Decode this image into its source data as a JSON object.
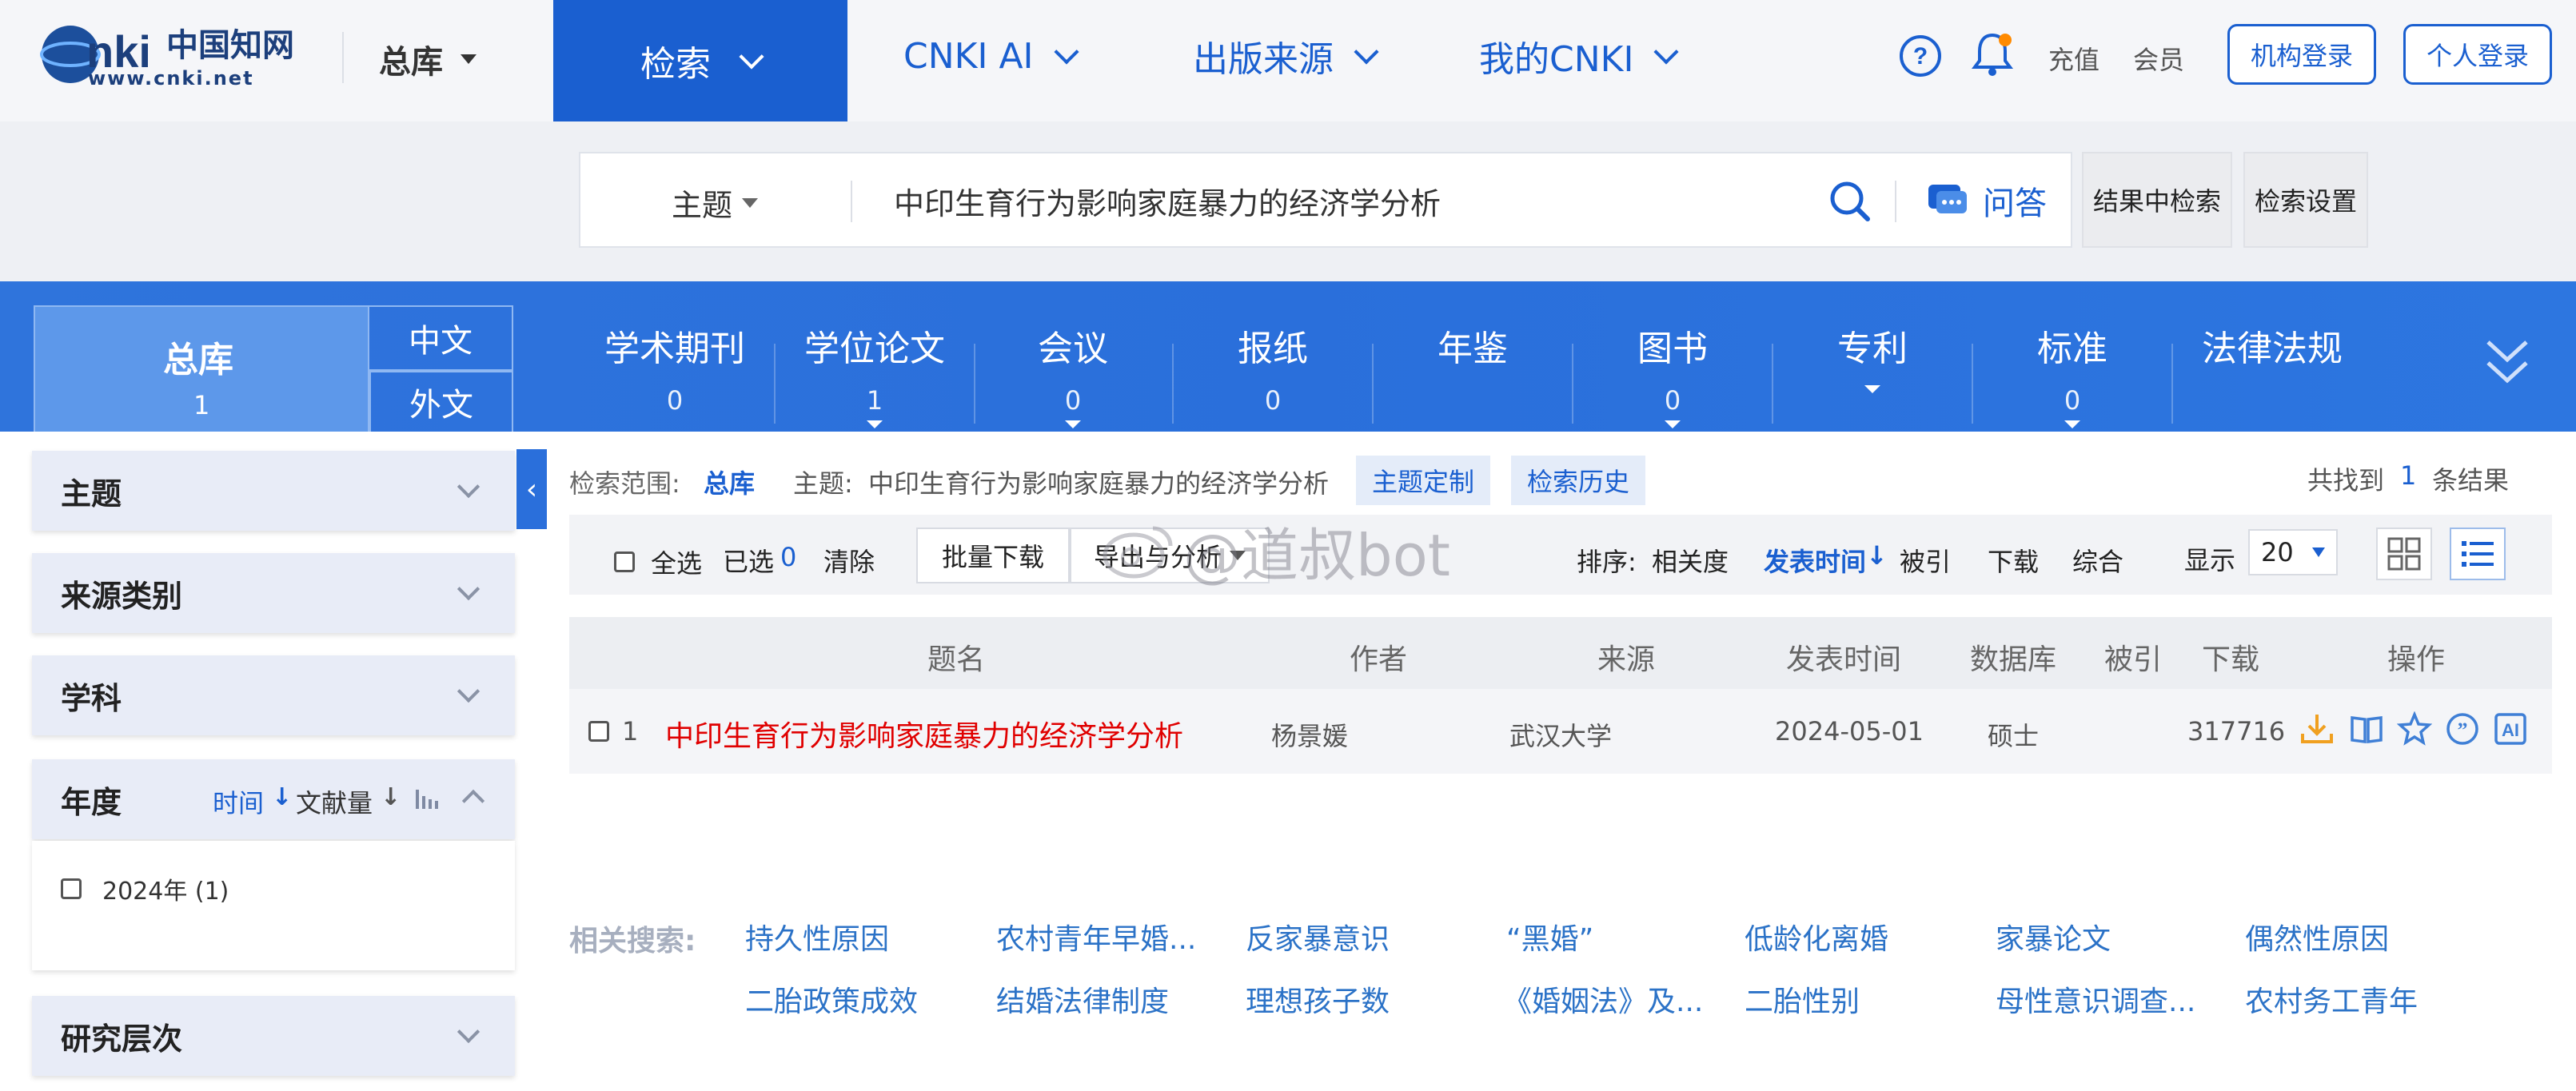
{
  "logo": {
    "text_cn": "中国知网",
    "text_url": "www.cnki.net"
  },
  "header": {
    "library_label": "总库",
    "nav": [
      {
        "label": "检索"
      },
      {
        "label": "CNKI AI"
      },
      {
        "label": "出版来源"
      },
      {
        "label": "我的CNKI"
      }
    ],
    "recharge": "充值",
    "member": "会员",
    "inst_login": "机构登录",
    "personal_login": "个人登录"
  },
  "search": {
    "field": "主题",
    "query": "中印生育行为影响家庭暴力的经济学分析",
    "qa_label": "问答",
    "within_results": "结果中检索",
    "settings": "检索设置"
  },
  "databases": {
    "total": {
      "label": "总库",
      "count": "1"
    },
    "lang_cn": "中文",
    "lang_foreign": "外文",
    "tabs": [
      {
        "label": "学术期刊",
        "count": "0"
      },
      {
        "label": "学位论文",
        "count": "1"
      },
      {
        "label": "会议",
        "count": "0"
      },
      {
        "label": "报纸",
        "count": "0"
      },
      {
        "label": "年鉴",
        "count": ""
      },
      {
        "label": "图书",
        "count": "0"
      },
      {
        "label": "专利",
        "count": ""
      },
      {
        "label": "标准",
        "count": "0"
      },
      {
        "label": "法律法规",
        "count": ""
      }
    ]
  },
  "sidebar": {
    "facets": [
      "主题",
      "来源类别",
      "学科"
    ],
    "year": {
      "title": "年度",
      "sort_time": "时间",
      "sort_count": "文献量",
      "options": [
        {
          "label": "2024年 (1)"
        }
      ]
    },
    "level": "研究层次"
  },
  "results": {
    "scope_label": "检索范围:",
    "scope_value": "总库",
    "topic_label": "主题:",
    "topic_value": "中印生育行为影响家庭暴力的经济学分析",
    "custom_topic": "主题定制",
    "history": "检索历史",
    "found_prefix": "共找到",
    "found_count": "1",
    "found_suffix": "条结果",
    "toolbar": {
      "select_all": "全选",
      "selected": "已选",
      "selected_count": "0",
      "clear": "清除",
      "batch_download": "批量下载",
      "analysis": "导出与分析",
      "sort_label": "排序:",
      "sort_relevance": "相关度",
      "sort_date": "发表时间",
      "sort_cited": "被引",
      "sort_downloads": "下载",
      "sort_overall": "综合",
      "display_label": "显示",
      "page_size": "20"
    },
    "columns": [
      "题名",
      "作者",
      "来源",
      "发表时间",
      "数据库",
      "被引",
      "下载",
      "操作"
    ],
    "rows": [
      {
        "index": "1",
        "title": "中印生育行为影响家庭暴力的经济学分析",
        "author": "杨景媛",
        "source": "武汉大学",
        "date": "2024-05-01",
        "database": "硕士",
        "cited": "",
        "downloads": "317716"
      }
    ],
    "related_label": "相关搜索:",
    "related": [
      "持久性原因",
      "农村青年早婚...",
      "反家暴意识",
      "“黑婚”",
      "低龄化离婚",
      "家暴论文",
      "偶然性原因",
      "二胎政策成效",
      "结婚法律制度",
      "理想孩子数",
      "《婚姻法》及...",
      "二胎性别",
      "母性意识调查...",
      "农村务工青年"
    ]
  },
  "watermark": "@道叔bot",
  "colors": {
    "brand": "#1a5fd0",
    "title_red": "#e00000",
    "download_orange": "#f0a020"
  }
}
